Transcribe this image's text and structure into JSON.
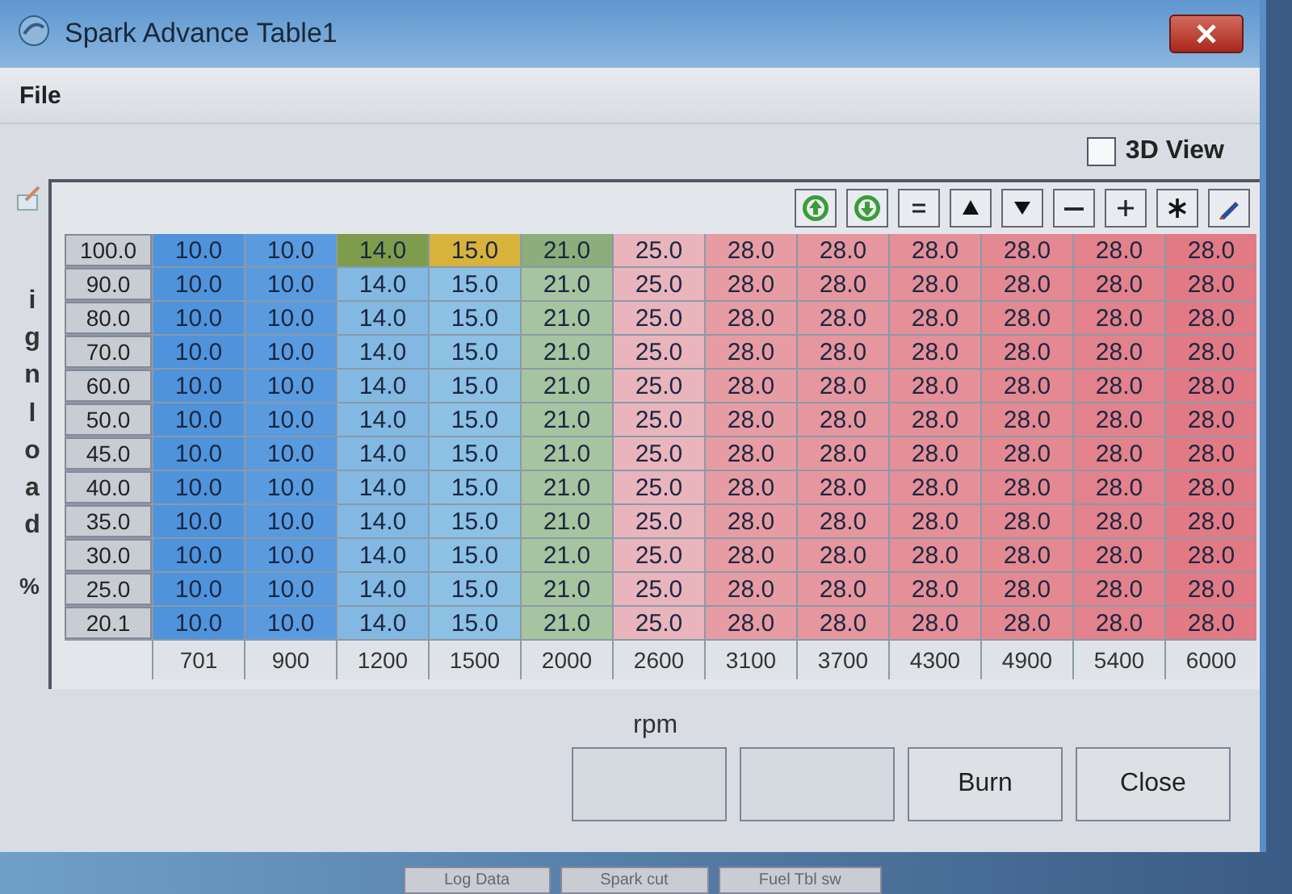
{
  "window": {
    "title": "Spark Advance Table1"
  },
  "menu": [
    "File"
  ],
  "view_3d": {
    "label": "3D View",
    "checked": false
  },
  "toolbar": [
    {
      "kind": "up"
    },
    {
      "kind": "down"
    },
    {
      "kind": "equals"
    },
    {
      "kind": "raise"
    },
    {
      "kind": "lower"
    },
    {
      "kind": "minus"
    },
    {
      "kind": "plus"
    },
    {
      "kind": "multiply"
    },
    {
      "kind": "edit"
    }
  ],
  "y_axis": {
    "label": "ignload",
    "unit": "%"
  },
  "table": {
    "rows": [
      {
        "load": "100.0",
        "cells": [
          {
            "value": "10.0",
            "color": "#4f93dc"
          },
          {
            "value": "10.0",
            "color": "#5a9be0"
          },
          {
            "value": "14.0",
            "color": "#7f9c4c"
          },
          {
            "value": "15.0",
            "color": "#d8b33c"
          },
          {
            "value": "21.0",
            "color": "#8cae7c"
          },
          {
            "value": "25.0",
            "color": "#e9b4bc"
          },
          {
            "value": "28.0",
            "color": "#e79ca4"
          },
          {
            "value": "28.0",
            "color": "#e6969e"
          },
          {
            "value": "28.0",
            "color": "#e58f98"
          },
          {
            "value": "28.0",
            "color": "#e48892"
          },
          {
            "value": "28.0",
            "color": "#e3828c"
          },
          {
            "value": "28.0",
            "color": "#e27a86"
          }
        ]
      },
      {
        "load": "90.0",
        "cells": [
          {
            "value": "10.0",
            "color": "#4f93dc"
          },
          {
            "value": "10.0",
            "color": "#5a9be0"
          },
          {
            "value": "14.0",
            "color": "#82b8e2"
          },
          {
            "value": "15.0",
            "color": "#8cc0e4"
          },
          {
            "value": "21.0",
            "color": "#a6c4a0"
          },
          {
            "value": "25.0",
            "color": "#e9b4bc"
          },
          {
            "value": "28.0",
            "color": "#e79ca4"
          },
          {
            "value": "28.0",
            "color": "#e6969e"
          },
          {
            "value": "28.0",
            "color": "#e58f98"
          },
          {
            "value": "28.0",
            "color": "#e48892"
          },
          {
            "value": "28.0",
            "color": "#e3828c"
          },
          {
            "value": "28.0",
            "color": "#e27a86"
          }
        ]
      },
      {
        "load": "80.0",
        "cells": [
          {
            "value": "10.0",
            "color": "#4f93dc"
          },
          {
            "value": "10.0",
            "color": "#5a9be0"
          },
          {
            "value": "14.0",
            "color": "#82b8e2"
          },
          {
            "value": "15.0",
            "color": "#8cc0e4"
          },
          {
            "value": "21.0",
            "color": "#a6c4a0"
          },
          {
            "value": "25.0",
            "color": "#e9b4bc"
          },
          {
            "value": "28.0",
            "color": "#e79ca4"
          },
          {
            "value": "28.0",
            "color": "#e6969e"
          },
          {
            "value": "28.0",
            "color": "#e58f98"
          },
          {
            "value": "28.0",
            "color": "#e48892"
          },
          {
            "value": "28.0",
            "color": "#e3828c"
          },
          {
            "value": "28.0",
            "color": "#e27a86"
          }
        ]
      },
      {
        "load": "70.0",
        "cells": [
          {
            "value": "10.0",
            "color": "#4f93dc"
          },
          {
            "value": "10.0",
            "color": "#5a9be0"
          },
          {
            "value": "14.0",
            "color": "#82b8e2"
          },
          {
            "value": "15.0",
            "color": "#8cc0e4"
          },
          {
            "value": "21.0",
            "color": "#a6c4a0"
          },
          {
            "value": "25.0",
            "color": "#e9b4bc"
          },
          {
            "value": "28.0",
            "color": "#e79ca4"
          },
          {
            "value": "28.0",
            "color": "#e6969e"
          },
          {
            "value": "28.0",
            "color": "#e58f98"
          },
          {
            "value": "28.0",
            "color": "#e48892"
          },
          {
            "value": "28.0",
            "color": "#e3828c"
          },
          {
            "value": "28.0",
            "color": "#e27a86"
          }
        ]
      },
      {
        "load": "60.0",
        "cells": [
          {
            "value": "10.0",
            "color": "#4f93dc"
          },
          {
            "value": "10.0",
            "color": "#5a9be0"
          },
          {
            "value": "14.0",
            "color": "#82b8e2"
          },
          {
            "value": "15.0",
            "color": "#8cc0e4"
          },
          {
            "value": "21.0",
            "color": "#a6c4a0"
          },
          {
            "value": "25.0",
            "color": "#e9b4bc"
          },
          {
            "value": "28.0",
            "color": "#e79ca4"
          },
          {
            "value": "28.0",
            "color": "#e6969e"
          },
          {
            "value": "28.0",
            "color": "#e58f98"
          },
          {
            "value": "28.0",
            "color": "#e48892"
          },
          {
            "value": "28.0",
            "color": "#e3828c"
          },
          {
            "value": "28.0",
            "color": "#e27a86"
          }
        ]
      },
      {
        "load": "50.0",
        "cells": [
          {
            "value": "10.0",
            "color": "#4f93dc"
          },
          {
            "value": "10.0",
            "color": "#5a9be0"
          },
          {
            "value": "14.0",
            "color": "#82b8e2"
          },
          {
            "value": "15.0",
            "color": "#8cc0e4"
          },
          {
            "value": "21.0",
            "color": "#a6c4a0"
          },
          {
            "value": "25.0",
            "color": "#e9b4bc"
          },
          {
            "value": "28.0",
            "color": "#e79ca4"
          },
          {
            "value": "28.0",
            "color": "#e6969e"
          },
          {
            "value": "28.0",
            "color": "#e58f98"
          },
          {
            "value": "28.0",
            "color": "#e48892"
          },
          {
            "value": "28.0",
            "color": "#e3828c"
          },
          {
            "value": "28.0",
            "color": "#e27a86"
          }
        ]
      },
      {
        "load": "45.0",
        "cells": [
          {
            "value": "10.0",
            "color": "#4f93dc"
          },
          {
            "value": "10.0",
            "color": "#5a9be0"
          },
          {
            "value": "14.0",
            "color": "#82b8e2"
          },
          {
            "value": "15.0",
            "color": "#8cc0e4"
          },
          {
            "value": "21.0",
            "color": "#a6c4a0"
          },
          {
            "value": "25.0",
            "color": "#e9b4bc"
          },
          {
            "value": "28.0",
            "color": "#e79ca4"
          },
          {
            "value": "28.0",
            "color": "#e6969e"
          },
          {
            "value": "28.0",
            "color": "#e58f98"
          },
          {
            "value": "28.0",
            "color": "#e48892"
          },
          {
            "value": "28.0",
            "color": "#e3828c"
          },
          {
            "value": "28.0",
            "color": "#e27a86"
          }
        ]
      },
      {
        "load": "40.0",
        "cells": [
          {
            "value": "10.0",
            "color": "#4f93dc"
          },
          {
            "value": "10.0",
            "color": "#5a9be0"
          },
          {
            "value": "14.0",
            "color": "#82b8e2"
          },
          {
            "value": "15.0",
            "color": "#8cc0e4"
          },
          {
            "value": "21.0",
            "color": "#a6c4a0"
          },
          {
            "value": "25.0",
            "color": "#e9b4bc"
          },
          {
            "value": "28.0",
            "color": "#e79ca4"
          },
          {
            "value": "28.0",
            "color": "#e6969e"
          },
          {
            "value": "28.0",
            "color": "#e58f98"
          },
          {
            "value": "28.0",
            "color": "#e48892"
          },
          {
            "value": "28.0",
            "color": "#e3828c"
          },
          {
            "value": "28.0",
            "color": "#e27a86"
          }
        ]
      },
      {
        "load": "35.0",
        "cells": [
          {
            "value": "10.0",
            "color": "#4f93dc"
          },
          {
            "value": "10.0",
            "color": "#5a9be0"
          },
          {
            "value": "14.0",
            "color": "#82b8e2"
          },
          {
            "value": "15.0",
            "color": "#8cc0e4"
          },
          {
            "value": "21.0",
            "color": "#a6c4a0"
          },
          {
            "value": "25.0",
            "color": "#e9b4bc"
          },
          {
            "value": "28.0",
            "color": "#e79ca4"
          },
          {
            "value": "28.0",
            "color": "#e6969e"
          },
          {
            "value": "28.0",
            "color": "#e58f98"
          },
          {
            "value": "28.0",
            "color": "#e48892"
          },
          {
            "value": "28.0",
            "color": "#e3828c"
          },
          {
            "value": "28.0",
            "color": "#e27a86"
          }
        ]
      },
      {
        "load": "30.0",
        "cells": [
          {
            "value": "10.0",
            "color": "#4f93dc"
          },
          {
            "value": "10.0",
            "color": "#5a9be0"
          },
          {
            "value": "14.0",
            "color": "#82b8e2"
          },
          {
            "value": "15.0",
            "color": "#8cc0e4"
          },
          {
            "value": "21.0",
            "color": "#a6c4a0"
          },
          {
            "value": "25.0",
            "color": "#e9b4bc"
          },
          {
            "value": "28.0",
            "color": "#e79ca4"
          },
          {
            "value": "28.0",
            "color": "#e6969e"
          },
          {
            "value": "28.0",
            "color": "#e58f98"
          },
          {
            "value": "28.0",
            "color": "#e48892"
          },
          {
            "value": "28.0",
            "color": "#e3828c"
          },
          {
            "value": "28.0",
            "color": "#e27a86"
          }
        ]
      },
      {
        "load": "25.0",
        "cells": [
          {
            "value": "10.0",
            "color": "#4f93dc"
          },
          {
            "value": "10.0",
            "color": "#5a9be0"
          },
          {
            "value": "14.0",
            "color": "#82b8e2"
          },
          {
            "value": "15.0",
            "color": "#8cc0e4"
          },
          {
            "value": "21.0",
            "color": "#a6c4a0"
          },
          {
            "value": "25.0",
            "color": "#e9b4bc"
          },
          {
            "value": "28.0",
            "color": "#e79ca4"
          },
          {
            "value": "28.0",
            "color": "#e6969e"
          },
          {
            "value": "28.0",
            "color": "#e58f98"
          },
          {
            "value": "28.0",
            "color": "#e48892"
          },
          {
            "value": "28.0",
            "color": "#e3828c"
          },
          {
            "value": "28.0",
            "color": "#e27a86"
          }
        ]
      },
      {
        "load": "20.1",
        "cells": [
          {
            "value": "10.0",
            "color": "#4f93dc"
          },
          {
            "value": "10.0",
            "color": "#5a9be0"
          },
          {
            "value": "14.0",
            "color": "#82b8e2"
          },
          {
            "value": "15.0",
            "color": "#8cc0e4"
          },
          {
            "value": "21.0",
            "color": "#a6c4a0"
          },
          {
            "value": "25.0",
            "color": "#e9b4bc"
          },
          {
            "value": "28.0",
            "color": "#e79ca4"
          },
          {
            "value": "28.0",
            "color": "#e6969e"
          },
          {
            "value": "28.0",
            "color": "#e58f98"
          },
          {
            "value": "28.0",
            "color": "#e48892"
          },
          {
            "value": "28.0",
            "color": "#e3828c"
          },
          {
            "value": "28.0",
            "color": "#e27a86"
          }
        ]
      }
    ],
    "rpm": [
      "701",
      "900",
      "1200",
      "1500",
      "2000",
      "2600",
      "3100",
      "3700",
      "4300",
      "4900",
      "5400",
      "6000"
    ]
  },
  "x_axis": {
    "label": "rpm"
  },
  "buttons": [
    {
      "kind": "blank"
    },
    {
      "kind": "blank"
    },
    {
      "label": "Burn",
      "kind": "action"
    },
    {
      "label": "Close",
      "kind": "action"
    }
  ],
  "background_strip": [
    "Log Data",
    "Spark cut",
    "Fuel Tbl sw"
  ]
}
